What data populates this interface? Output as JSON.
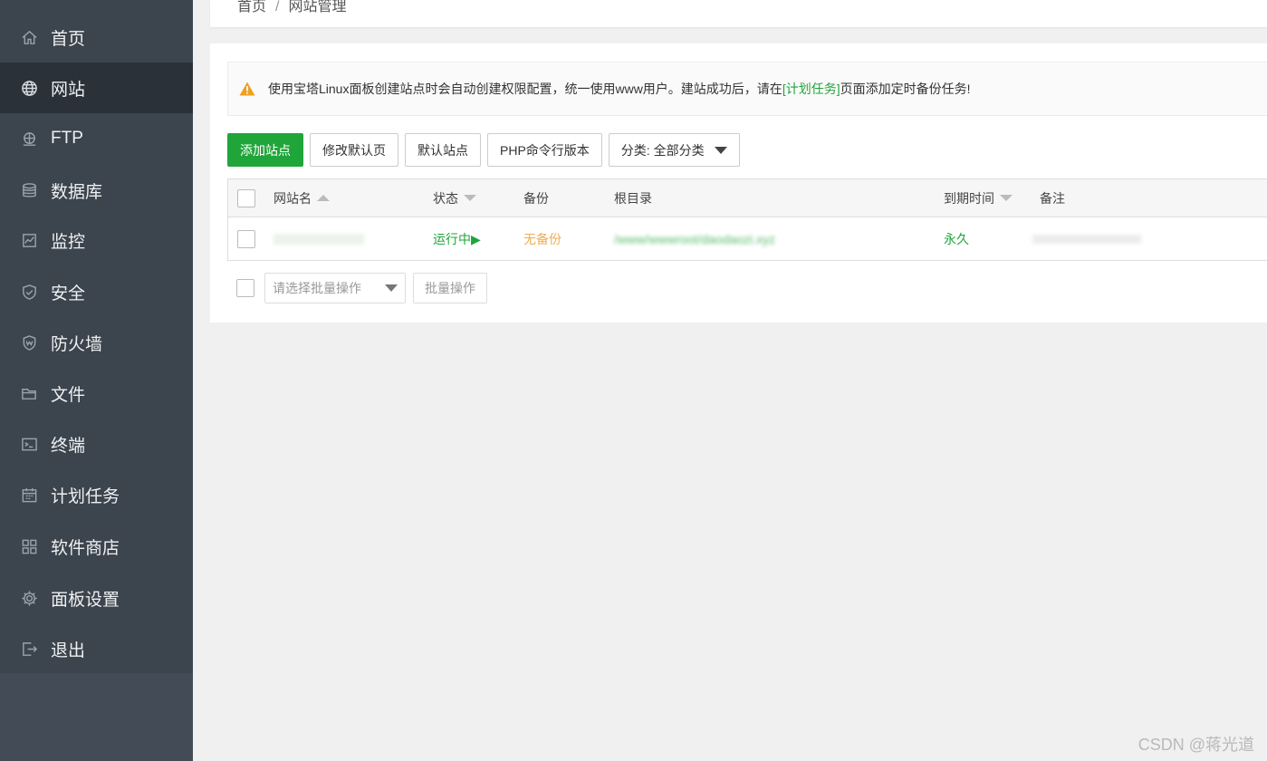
{
  "sidebar": {
    "items": [
      {
        "label": "首页",
        "icon": "home-icon"
      },
      {
        "label": "网站",
        "icon": "globe-icon",
        "active": true
      },
      {
        "label": "FTP",
        "icon": "ftp-icon"
      },
      {
        "label": "数据库",
        "icon": "database-icon"
      },
      {
        "label": "监控",
        "icon": "monitor-icon"
      },
      {
        "label": "安全",
        "icon": "shield-icon"
      },
      {
        "label": "防火墙",
        "icon": "waf-icon"
      },
      {
        "label": "文件",
        "icon": "folder-icon"
      },
      {
        "label": "终端",
        "icon": "terminal-icon"
      },
      {
        "label": "计划任务",
        "icon": "calendar-icon"
      },
      {
        "label": "软件商店",
        "icon": "apps-icon"
      },
      {
        "label": "面板设置",
        "icon": "gear-icon"
      },
      {
        "label": "退出",
        "icon": "logout-icon"
      }
    ]
  },
  "breadcrumb": {
    "home": "首页",
    "separator": "/",
    "current": "网站管理"
  },
  "alert": {
    "text_before": "使用宝塔Linux面板创建站点时会自动创建权限配置，统一使用www用户。建站成功后，请在",
    "link": "[计划任务]",
    "text_after": "页面添加定时备份任务!"
  },
  "toolbar": {
    "add_site": "添加站点",
    "edit_default_page": "修改默认页",
    "default_site": "默认站点",
    "php_cli_version": "PHP命令行版本",
    "category": "分类: 全部分类"
  },
  "table": {
    "headers": {
      "name": "网站名",
      "status": "状态",
      "backup": "备份",
      "root": "根目录",
      "expire": "到期时间",
      "remark": "备注"
    },
    "rows": [
      {
        "name": "",
        "status": "运行中▶",
        "backup": "无备份",
        "root": "/www/wwwroot/daodaozi.xyz",
        "expire": "永久",
        "remark": ""
      }
    ]
  },
  "batch": {
    "select_placeholder": "请选择批量操作",
    "button": "批量操作"
  },
  "watermark": "CSDN @蒋光道",
  "colors": {
    "sidebar_bg": "#3c444d",
    "sidebar_active": "#2b3138",
    "accent_green": "#20a53a",
    "backup_orange": "#f0ad4e"
  }
}
